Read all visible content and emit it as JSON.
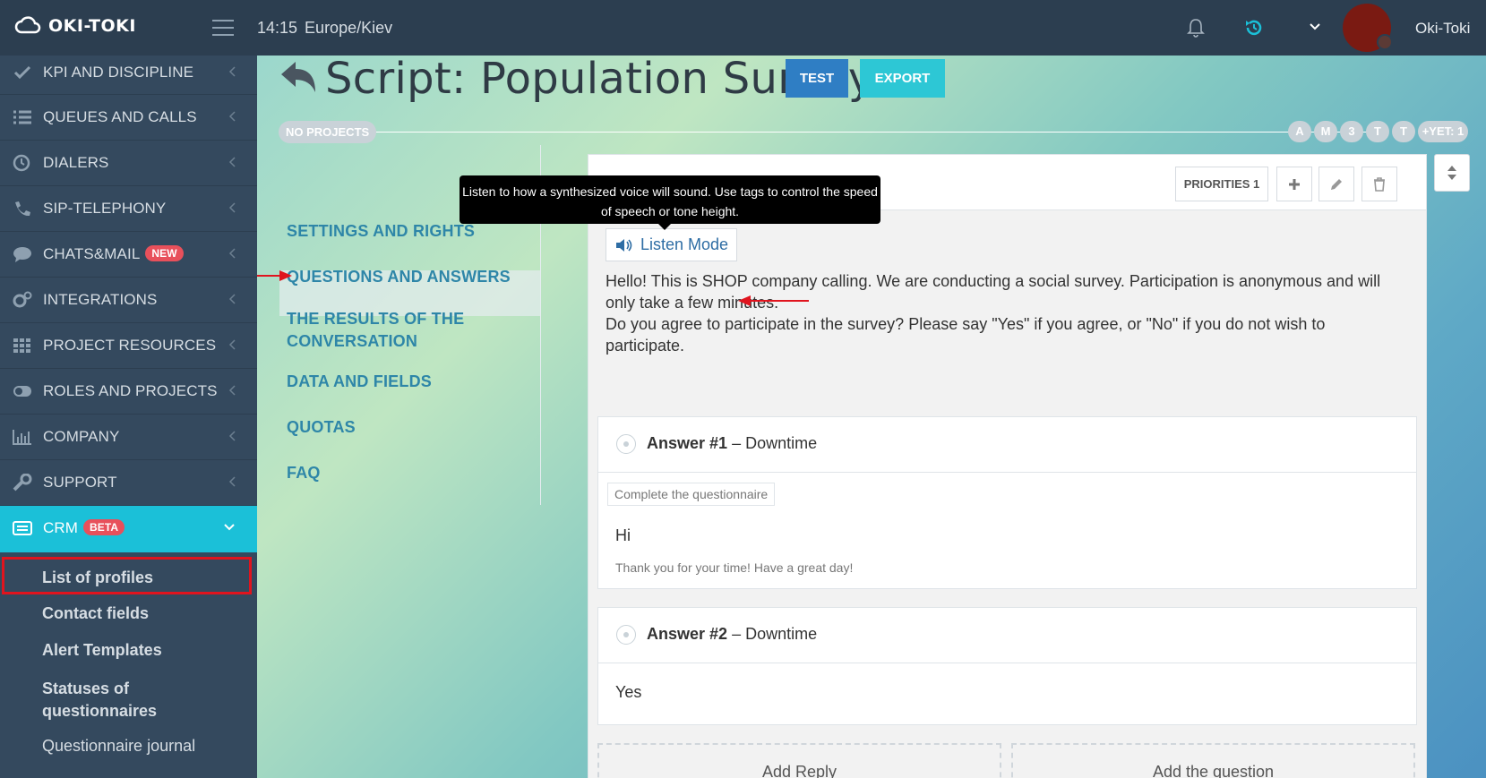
{
  "topbar": {
    "logo_text": "OKI-TOKI",
    "time": "14:15",
    "timezone": "Europe/Kiev",
    "username": "Oki-Toki"
  },
  "sidebar": {
    "items": [
      {
        "label": "KPI AND DISCIPLINE",
        "icon": "check-icon"
      },
      {
        "label": "QUEUES AND CALLS",
        "icon": "list-icon"
      },
      {
        "label": "DIALERS",
        "icon": "clock-icon"
      },
      {
        "label": "SIP-TELEPHONY",
        "icon": "phone-icon"
      },
      {
        "label": "CHATS&MAIL",
        "icon": "chat-icon",
        "badge": "NEW"
      },
      {
        "label": "INTEGRATIONS",
        "icon": "cogs-icon"
      },
      {
        "label": "PROJECT RESOURCES",
        "icon": "grid-icon"
      },
      {
        "label": "ROLES AND PROJECTS",
        "icon": "toggle-icon"
      },
      {
        "label": "COMPANY",
        "icon": "bar-chart-icon"
      },
      {
        "label": "SUPPORT",
        "icon": "wrench-icon"
      }
    ],
    "crm": {
      "label": "CRM",
      "badge": "BETA",
      "icon": "crm-icon"
    },
    "crm_sub": [
      "List of profiles",
      "Contact fields",
      "Alert Templates",
      "Statuses of questionnaires",
      "Questionnaire journal"
    ]
  },
  "page": {
    "title": "Script: Population Survey",
    "test_label": "TEST",
    "export_label": "EXPORT",
    "no_projects": "NO PROJECTS",
    "pills": [
      "A",
      "M",
      "3",
      "T",
      "T",
      "+YET: 1"
    ]
  },
  "leftnav": {
    "items": [
      "SETTINGS AND RIGHTS",
      "QUESTIONS AND ANSWERS",
      "THE RESULTS OF THE CONVERSATION",
      "DATA AND FIELDS",
      "QUOTAS",
      "FAQ"
    ]
  },
  "panel": {
    "priorities_label": "PRIORITIES 1",
    "listen_mode_label": "Listen Mode",
    "tooltip": "Listen to how a synthesized voice will sound. Use tags to control the speed of speech or tone height.",
    "question_line1": "Hello! This is SHOP company calling. We are conducting a social survey. Participation is anonymous and will only take a few minutes.",
    "question_line2": "Do you agree to participate in the survey? Please say \"Yes\" if you agree, or \"No\" if you do not wish to participate.",
    "answers": [
      {
        "title": "Answer #1",
        "subtitle": "– Downtime",
        "tag": "Complete the questionnaire",
        "text": "Hi",
        "note": "Thank you for your time! Have a great day!"
      },
      {
        "title": "Answer #2",
        "subtitle": "– Downtime",
        "text": "Yes"
      }
    ],
    "add_reply_label": "Add Reply",
    "add_question_label": "Add the question"
  },
  "colors": {
    "topbar": "#2c3e50",
    "sidebar": "#34495e",
    "accent_cyan": "#1bc0d8",
    "link_blue": "#2e86a8",
    "highlight_red": "#e0141e"
  }
}
